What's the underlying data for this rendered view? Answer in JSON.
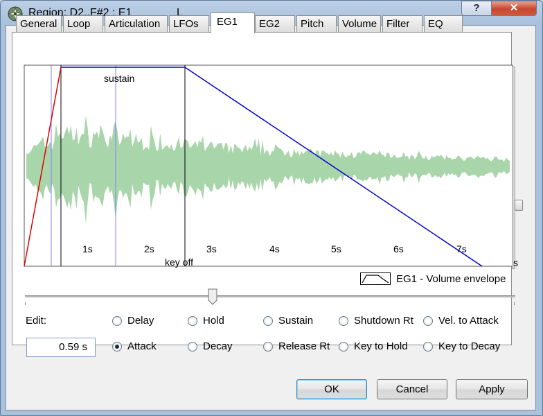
{
  "window": {
    "title": "Region: D2..F#2 : E1",
    "title_extra": "L",
    "help_label": "?",
    "close_label": "✕"
  },
  "tabs": [
    {
      "label": "General",
      "active": false
    },
    {
      "label": "Loop",
      "active": false
    },
    {
      "label": "Articulation",
      "active": false
    },
    {
      "label": "LFOs",
      "active": false
    },
    {
      "label": "EG1",
      "active": true
    },
    {
      "label": "EG2",
      "active": false
    },
    {
      "label": "Pitch",
      "active": false
    },
    {
      "label": "Volume",
      "active": false
    },
    {
      "label": "Filter",
      "active": false
    },
    {
      "label": "EQ",
      "active": false
    }
  ],
  "graph": {
    "sustain_label": "sustain",
    "keyoff_label": "key off",
    "time_labels": [
      "1s",
      "2s",
      "3s",
      "4s",
      "5s",
      "6s",
      "7s"
    ],
    "unit_label": "s",
    "waveform_color": "#a8d5a9",
    "attack_color": "#e00000",
    "envelope_color": "#0000d0"
  },
  "legend": {
    "label": "EG1 - Volume envelope",
    "icon": "envelope-shape-icon"
  },
  "edit": {
    "label": "Edit:",
    "value": "0.59 s"
  },
  "radios": [
    {
      "label": "Delay",
      "checked": false
    },
    {
      "label": "Hold",
      "checked": false
    },
    {
      "label": "Sustain",
      "checked": false
    },
    {
      "label": "Shutdown Rt",
      "checked": false
    },
    {
      "label": "Vel. to Attack",
      "checked": false
    },
    {
      "label": "Attack",
      "checked": true
    },
    {
      "label": "Decay",
      "checked": false
    },
    {
      "label": "Release Rt",
      "checked": false
    },
    {
      "label": "Key to Hold",
      "checked": false
    },
    {
      "label": "Key to Decay",
      "checked": false
    }
  ],
  "buttons": {
    "ok": "OK",
    "cancel": "Cancel",
    "apply": "Apply"
  }
}
